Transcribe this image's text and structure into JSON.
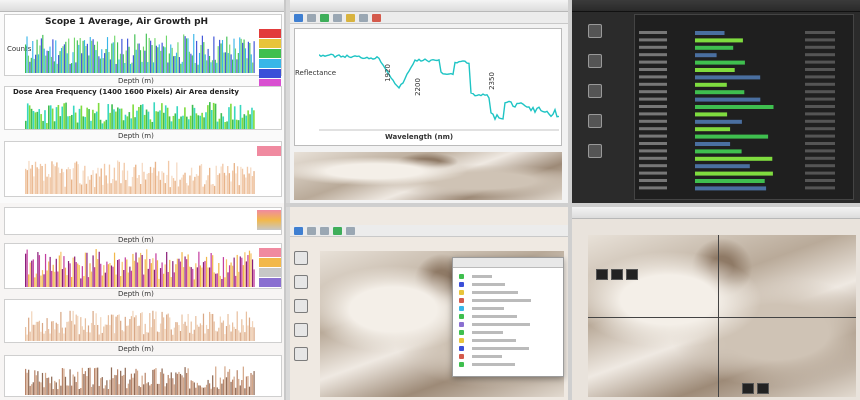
{
  "top_left": {
    "window_title": "",
    "chart1_title": "Scope 1 Average, Air Growth pH",
    "chart1_xlabel": "Depth (m)",
    "chart1_ylabel": "Counts",
    "chart2_title": "Dose Area Frequency (1400 1600 Pixels) Air Area density",
    "chart2_xlabel": "Depth (m)",
    "chart3_xlabel": "Depth (m)",
    "legend_colors": [
      "#e23b3b",
      "#e8c43a",
      "#3fbf4f",
      "#38b6e8",
      "#3b4fd8",
      "#d94fd1"
    ]
  },
  "bottom_left": {
    "chart4_xlabel": "Depth (m)",
    "chart5_xlabel": "Depth (m)",
    "chart6_xlabel": "Depth (m)",
    "legend_colors": [
      "#f08aa0",
      "#f2b84a",
      "#c7c7c7",
      "#8a6fd1"
    ]
  },
  "top_mid": {
    "window_title": "",
    "ylabel": "Reflectance",
    "xlabel": "Wavelength (nm)",
    "peak_labels": [
      "1920",
      "2200",
      "2350"
    ],
    "line_color": "#1fc4c4",
    "tab_label": ""
  },
  "bottom_mid": {
    "dialog_title": "",
    "dialog_rows": [
      {
        "label": "",
        "value": ""
      },
      {
        "label": "",
        "value": ""
      },
      {
        "label": "",
        "value": ""
      },
      {
        "label": "",
        "value": ""
      }
    ]
  },
  "top_right": {
    "window_title": "",
    "panel_title": "",
    "bar_colors": [
      "#3fbf4f",
      "#7fdc3f",
      "#3fbf4f",
      "#7fdc3f"
    ]
  },
  "bottom_right": {
    "window_title": ""
  }
}
